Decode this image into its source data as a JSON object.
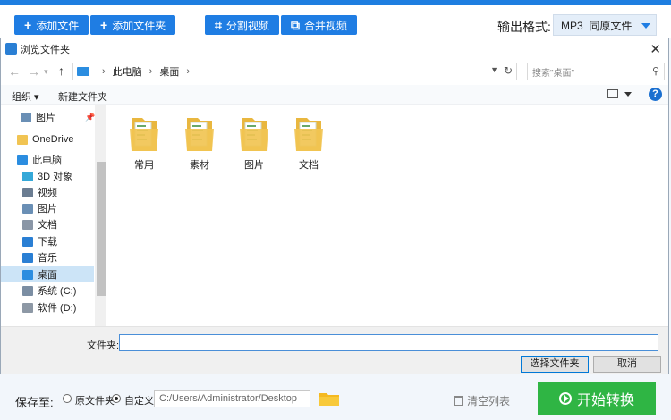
{
  "toolbar": {
    "add_file": "添加文件",
    "add_folder": "添加文件夹",
    "split_video": "分割视频",
    "merge_video": "合并视频",
    "output_format_label": "输出格式:",
    "output_format_value": "MP3  同原文件"
  },
  "dialog": {
    "title": "浏览文件夹",
    "address": {
      "root": "此电脑",
      "current": "桌面"
    },
    "search_placeholder": "搜索\"桌面\"",
    "organize": "组织 ▾",
    "new_folder": "新建文件夹",
    "help": "?",
    "sidebar": [
      {
        "label": "图片",
        "icon": "pictures-icon",
        "color": "#6a8fb5"
      },
      {
        "label": "OneDrive",
        "icon": "onedrive-folder-icon",
        "color": "#f1c453"
      },
      {
        "label": "此电脑",
        "icon": "computer-icon",
        "color": "#2b8de0"
      },
      {
        "label": "3D 对象",
        "icon": "3d-objects-icon",
        "color": "#35a8d8"
      },
      {
        "label": "视频",
        "icon": "videos-icon",
        "color": "#6b7d92"
      },
      {
        "label": "图片",
        "icon": "pictures-icon",
        "color": "#6a8fb5"
      },
      {
        "label": "文档",
        "icon": "documents-icon",
        "color": "#8a96a6"
      },
      {
        "label": "下载",
        "icon": "downloads-icon",
        "color": "#2a7fd4"
      },
      {
        "label": "音乐",
        "icon": "music-icon",
        "color": "#2a7fd4"
      },
      {
        "label": "桌面",
        "icon": "desktop-icon",
        "color": "#2b8de0"
      },
      {
        "label": "系统 (C:)",
        "icon": "drive-c-icon",
        "color": "#7b8ea3"
      },
      {
        "label": "软件 (D:)",
        "icon": "drive-d-icon",
        "color": "#8d98a5"
      }
    ],
    "folders": [
      "常用",
      "素材",
      "图片",
      "文档"
    ],
    "filename_label": "文件夹:",
    "filename_value": "",
    "select_button": "选择文件夹",
    "cancel_button": "取消"
  },
  "footer": {
    "save_to_label": "保存至:",
    "option_original": "原文件夹",
    "option_custom": "自定义",
    "path": "C:/Users/Administrator/Desktop",
    "clear_list": "清空列表",
    "start_convert": "开始转换"
  },
  "colors": {
    "accent": "#1f7de3",
    "start_green": "#2fb544",
    "folder_yellow": "#f1c453"
  }
}
